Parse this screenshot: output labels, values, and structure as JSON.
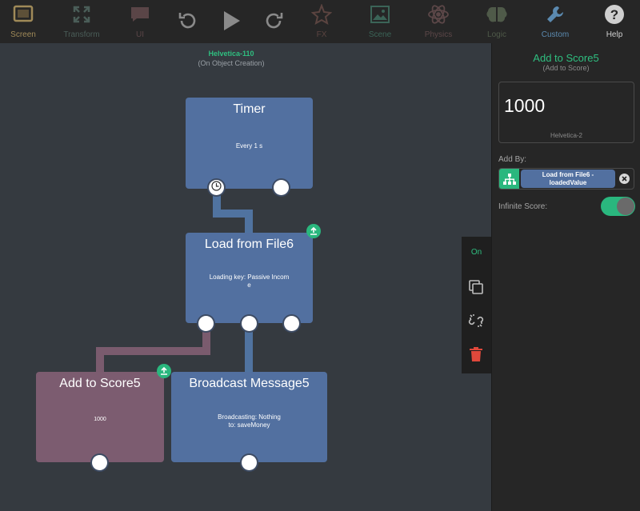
{
  "toolbar": {
    "screen": "Screen",
    "transform": "Transform",
    "ui": "UI",
    "fx": "FX",
    "scene": "Scene",
    "physics": "Physics",
    "logic": "Logic",
    "custom": "Custom",
    "help": "Help"
  },
  "canvas": {
    "title": "Helvetica-110",
    "subtitle": "(On Object Creation)"
  },
  "nodes": {
    "timer": {
      "title": "Timer",
      "body": "Every 1 s"
    },
    "load": {
      "title": "Load from File6",
      "body_line1": "Loading key: Passive Incom",
      "body_line2": "e"
    },
    "add": {
      "title": "Add to Score5",
      "body": "1000"
    },
    "broadcast": {
      "title": "Broadcast Message5",
      "body_line1": "Broadcasting: Nothing",
      "body_line2": "to: saveMoney"
    }
  },
  "node_tools": {
    "on": "On"
  },
  "panel": {
    "title": "Add to Score5",
    "subtitle": "(Add to Score)",
    "value": "1000",
    "value_font": "Helvetica-2",
    "add_by_label": "Add By:",
    "add_by_line1": "Load from File6 -",
    "add_by_line2": "loadedValue",
    "infinite_label": "Infinite Score:",
    "infinite_on": true
  },
  "colors": {
    "accent_green": "#2fbf80",
    "node_blue": "#5270a0",
    "node_pink": "#7c5c70",
    "delete_red": "#e0483b"
  }
}
